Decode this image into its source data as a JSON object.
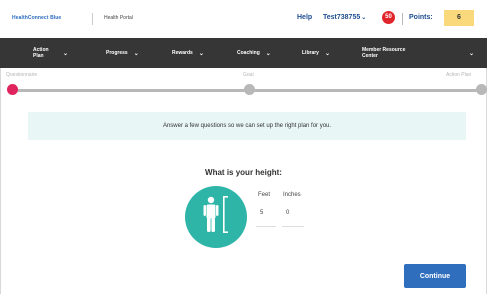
{
  "header": {
    "logo_text": "HealthConnect Blue",
    "portal_label": "Health Portal",
    "help_label": "Help",
    "username": "Test738755",
    "username_chevron": "⌄",
    "notification_count": "50",
    "points_label": "Points:",
    "points_value": "6"
  },
  "nav": {
    "items": [
      {
        "label": "Action Plan"
      },
      {
        "label": "Progress"
      },
      {
        "label": "Rewards"
      },
      {
        "label": "Coaching"
      },
      {
        "label": "Library"
      },
      {
        "label": "Member Resource Center"
      }
    ],
    "chevron": "⌄"
  },
  "progress": {
    "steps": [
      "Questionnaire",
      "Goal",
      "Action Plan"
    ],
    "current_step": 1,
    "active_color": "#e0245e"
  },
  "banner": {
    "text": "Answer a few questions so we can set up the right plan for you."
  },
  "question": {
    "title": "What is your height:",
    "feet_label": "Feet",
    "inches_label": "Inches",
    "feet_value": "5",
    "inches_value": "0",
    "icon": "person-height-icon",
    "icon_color": "#2fb5a8"
  },
  "actions": {
    "continue_label": "Continue",
    "continue_color": "#2f6dbd"
  }
}
